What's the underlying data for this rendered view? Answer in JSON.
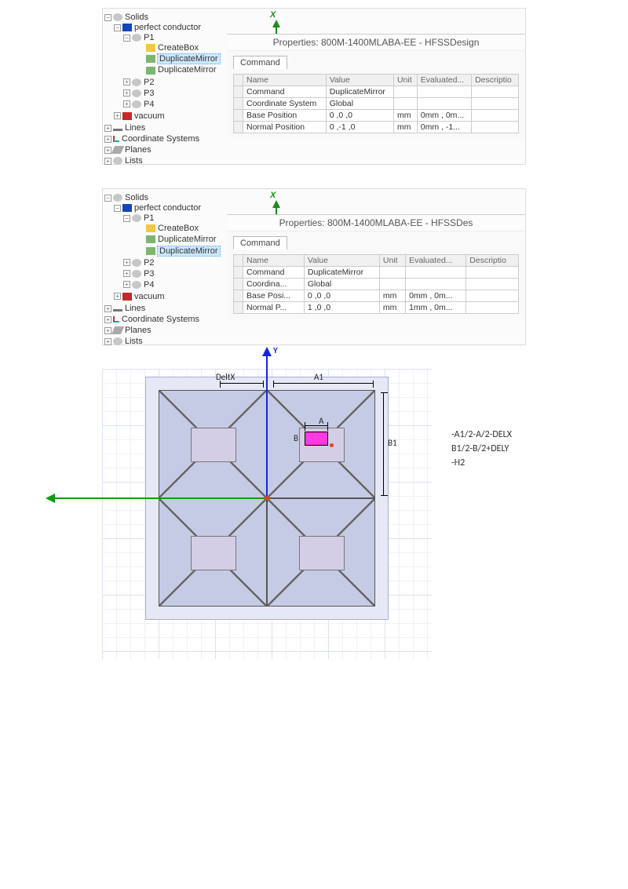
{
  "tree": {
    "solids": "Solids",
    "perfect_conductor": "perfect conductor",
    "p1": "P1",
    "createbox": "CreateBox",
    "dupmirror": "DuplicateMirror",
    "p2": "P2",
    "p3": "P3",
    "p4": "P4",
    "vacuum": "vacuum",
    "lines": "Lines",
    "coord": "Coordinate Systems",
    "planes": "Planes",
    "lists": "Lists"
  },
  "props1": {
    "title": "Properties: 800M-1400MLABA-EE - HFSSDesign",
    "tab": "Command",
    "headers": [
      "Name",
      "Value",
      "Unit",
      "Evaluated...",
      "Descriptio"
    ],
    "rows": [
      {
        "name": "Command",
        "value": "DuplicateMirror",
        "unit": "",
        "eval": "",
        "desc": ""
      },
      {
        "name": "Coordinate System",
        "value": "Global",
        "unit": "",
        "eval": "",
        "desc": ""
      },
      {
        "name": "Base Position",
        "value": "0 ,0 ,0",
        "unit": "mm",
        "eval": "0mm , 0m...",
        "desc": ""
      },
      {
        "name": "Normal Position",
        "value": "0 ,-1 ,0",
        "unit": "mm",
        "eval": "0mm , -1...",
        "desc": ""
      }
    ]
  },
  "props2": {
    "title": "Properties: 800M-1400MLABA-EE - HFSSDes",
    "tab": "Command",
    "headers": [
      "Name",
      "Value",
      "Unit",
      "Evaluated...",
      "Descriptio"
    ],
    "rows": [
      {
        "name": "Command",
        "value": "DuplicateMirror",
        "unit": "",
        "eval": "",
        "desc": ""
      },
      {
        "name": "Coordina...",
        "value": "Global",
        "unit": "",
        "eval": "",
        "desc": ""
      },
      {
        "name": "Base Posi...",
        "value": "0 ,0 ,0",
        "unit": "mm",
        "eval": "0mm , 0m...",
        "desc": ""
      },
      {
        "name": "Normal P...",
        "value": "1 ,0 ,0",
        "unit": "mm",
        "eval": "1mm , 0m...",
        "desc": ""
      }
    ]
  },
  "diagram": {
    "axisX": "X",
    "axisY": "Y",
    "deltx": "DeltX",
    "A1": "A1",
    "B1": "B1",
    "A": "A",
    "B": "B",
    "formulas": [
      "-A1/2-A/2-DELX",
      "B1/2-B/2+DELY",
      "-H2"
    ]
  }
}
